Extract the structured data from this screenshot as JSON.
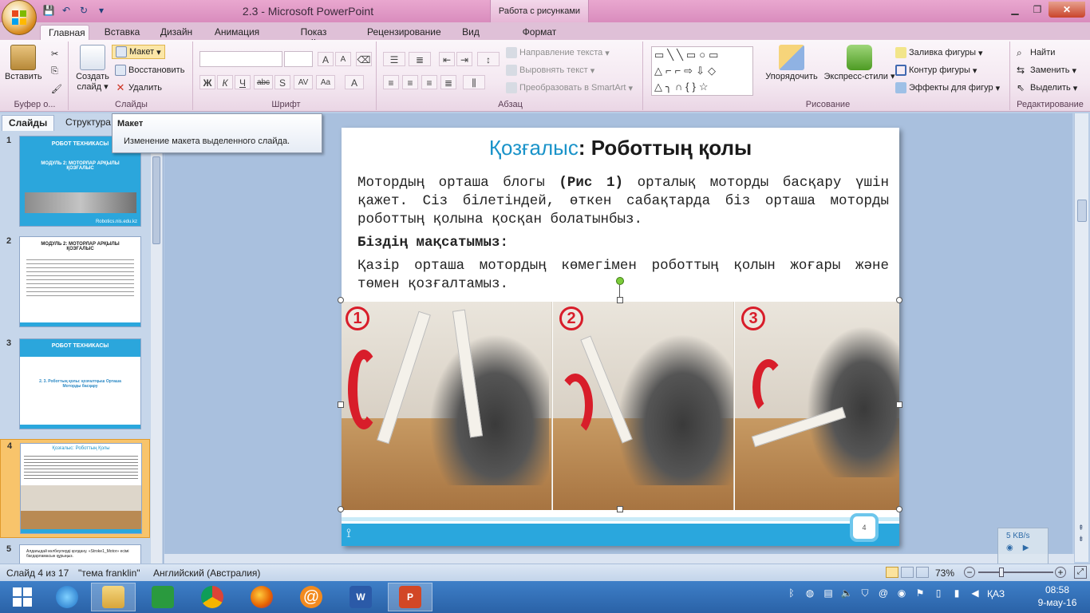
{
  "window": {
    "title": "2.3 - Microsoft PowerPoint",
    "context_group": "Работа с рисунками"
  },
  "qat": {
    "save": "💾",
    "undo": "↶",
    "redo": "↻",
    "more": "▾"
  },
  "tabs": [
    "Главная",
    "Вставка",
    "Дизайн",
    "Анимация",
    "Показ слайдов",
    "Рецензирование",
    "Вид",
    "Формат"
  ],
  "ribbon": {
    "clipboard": {
      "label": "Буфер о...",
      "paste": "Вставить"
    },
    "slides": {
      "label": "Слайды",
      "new_slide": "Создать слайд",
      "layout": "Макет",
      "reset": "Восстановить",
      "delete": "Удалить"
    },
    "font": {
      "label": "Шрифт",
      "bold": "Ж",
      "italic": "К",
      "underline": "Ч",
      "strike": "abc",
      "shadow": "S",
      "spacing": "AV",
      "case": "Aa",
      "color": "A",
      "grow": "A",
      "shrink": "A"
    },
    "paragraph": {
      "label": "Абзац",
      "text_direction": "Направление текста",
      "align_text": "Выровнять текст",
      "smartart": "Преобразовать в SmartArt"
    },
    "drawing": {
      "label": "Рисование",
      "arrange": "Упорядочить",
      "quick_styles": "Экспресс-стили",
      "fill": "Заливка фигуры",
      "outline": "Контур фигуры",
      "effects": "Эффекты для фигур"
    },
    "editing": {
      "label": "Редактирование",
      "find": "Найти",
      "replace": "Заменить",
      "select": "Выделить"
    }
  },
  "tooltip": {
    "title": "Макет",
    "description": "Изменение макета выделенного слайда."
  },
  "pane": {
    "tab_slides": "Слайды",
    "tab_outline": "Структура"
  },
  "thumbnails": [
    {
      "num": "1",
      "header": "РОБОТ ТЕХНИКАСЫ",
      "title": "МОДУЛЬ 2: МОТОРЛАР АРҚЫЛЫ ҚОЗҒАЛЫС",
      "footer": "Robotics.nis.edu.kz"
    },
    {
      "num": "2",
      "header": "МОДУЛЬ 2: МОТОРЛАР АРҚЫЛЫ ҚОЗҒАЛЫС",
      "title": ""
    },
    {
      "num": "3",
      "header": "РОБОТ ТЕХНИКАСЫ",
      "title": "2. 3. Роботтың қолы: қозғалтқыш Орташа Моторды басқару"
    },
    {
      "num": "4",
      "header": "Қозғалыс: Роботтың Қолы",
      "title": ""
    },
    {
      "num": "5",
      "header": "Алдағыдай көлбеулерді қолдану. «Stroke1_Motor» есімі бағдарламасын құрыңыз.",
      "title": ""
    }
  ],
  "slide": {
    "title_highlight": "Қозғалыс",
    "title_rest": ": Роботтың қолы",
    "para1_a": "Мотордың орташа блогы ",
    "para1_b": "(Рис 1)",
    "para1_c": " орталық моторды басқару үшін қажет. Сіз білетіндей, өткен сабақтарда біз орташа моторды роботтың қолына қосқан болатынбыз.",
    "goal_label": "Біздің мақсатымыз:",
    "para2": "Қазір орташа мотордың көмегімен роботтың қолын жоғары және төмен қозғалтамыз.",
    "badges": [
      "1",
      "2",
      "3"
    ],
    "page_num": "4"
  },
  "status": {
    "slide": "Слайд 4 из 17",
    "theme": "\"тема franklin\"",
    "lang": "Английский (Австралия)",
    "zoom": "73%"
  },
  "netmon": {
    "speed": "5 KB/s"
  },
  "tray": {
    "lang": "ҚАЗ",
    "time": "08:58",
    "date": "9-мау-16"
  },
  "colors": {
    "accent": "#1a93c9",
    "arrow_red": "#d81d2a",
    "footer_blue": "#2aa7dd"
  }
}
